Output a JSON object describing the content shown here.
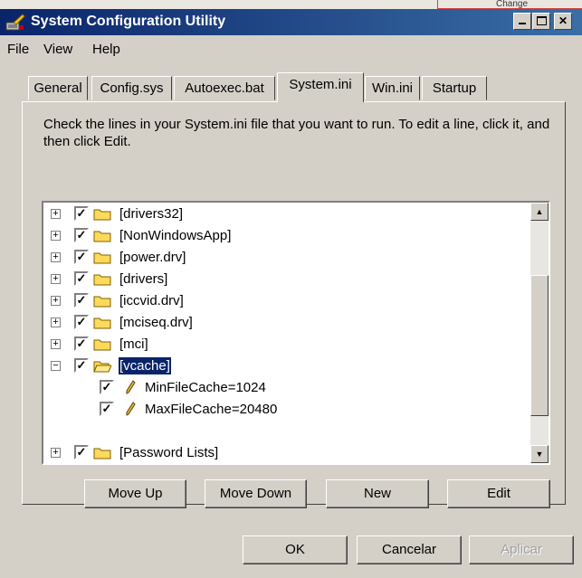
{
  "window": {
    "title": "System Configuration Utility"
  },
  "top_strip_text": "Change",
  "menu": [
    {
      "label": "File"
    },
    {
      "label": "View"
    },
    {
      "label": "Help"
    }
  ],
  "tabs": [
    {
      "label": "General"
    },
    {
      "label": "Config.sys"
    },
    {
      "label": "Autoexec.bat"
    },
    {
      "label": "System.ini"
    },
    {
      "label": "Win.ini"
    },
    {
      "label": "Startup"
    }
  ],
  "active_tab": "System.ini",
  "description": "Check the lines in your System.ini file that you want to run. To edit a line, click it, and then click Edit.",
  "tree_items": [
    {
      "label": "[drivers32]",
      "checked": true,
      "expanded": false,
      "kind": "section"
    },
    {
      "label": "[NonWindowsApp]",
      "checked": true,
      "expanded": false,
      "kind": "section"
    },
    {
      "label": "[power.drv]",
      "checked": true,
      "expanded": false,
      "kind": "section"
    },
    {
      "label": "[drivers]",
      "checked": true,
      "expanded": false,
      "kind": "section"
    },
    {
      "label": "[iccvid.drv]",
      "checked": true,
      "expanded": false,
      "kind": "section"
    },
    {
      "label": "[mciseq.drv]",
      "checked": true,
      "expanded": false,
      "kind": "section"
    },
    {
      "label": "[mci]",
      "checked": true,
      "expanded": false,
      "kind": "section"
    },
    {
      "label": "[vcache]",
      "checked": true,
      "expanded": true,
      "kind": "section",
      "selected": true
    },
    {
      "label": "MinFileCache=1024",
      "checked": true,
      "kind": "entry"
    },
    {
      "label": "MaxFileCache=20480",
      "checked": true,
      "kind": "entry"
    },
    {
      "label": "[Password Lists]",
      "checked": true,
      "expanded": false,
      "kind": "section"
    }
  ],
  "action_buttons": {
    "move_up": {
      "label": "Move Up"
    },
    "move_down": {
      "label": "Move Down"
    },
    "new": {
      "label": "New"
    },
    "edit": {
      "label": "Edit"
    }
  },
  "dialog_buttons": {
    "ok": {
      "label": "OK"
    },
    "cancel": {
      "label": "Cancelar"
    },
    "apply": {
      "label": "Aplicar",
      "enabled": false
    }
  },
  "colors": {
    "titlebar": "#0a246a",
    "selection": "#0a246a",
    "face": "#d4d0c8"
  }
}
